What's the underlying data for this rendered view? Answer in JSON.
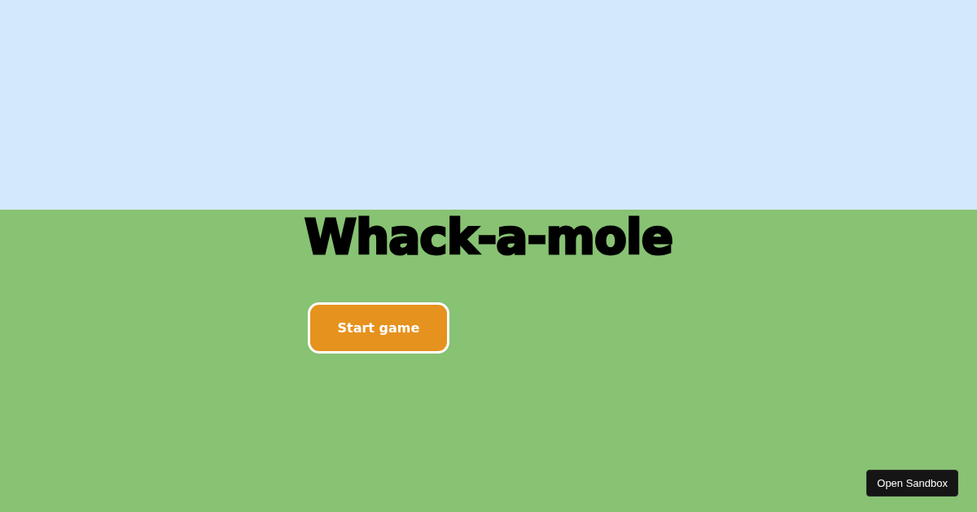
{
  "title": "Whack-a-mole",
  "start_button": {
    "label": "Start game"
  },
  "sandbox_button": {
    "label": "Open Sandbox"
  }
}
